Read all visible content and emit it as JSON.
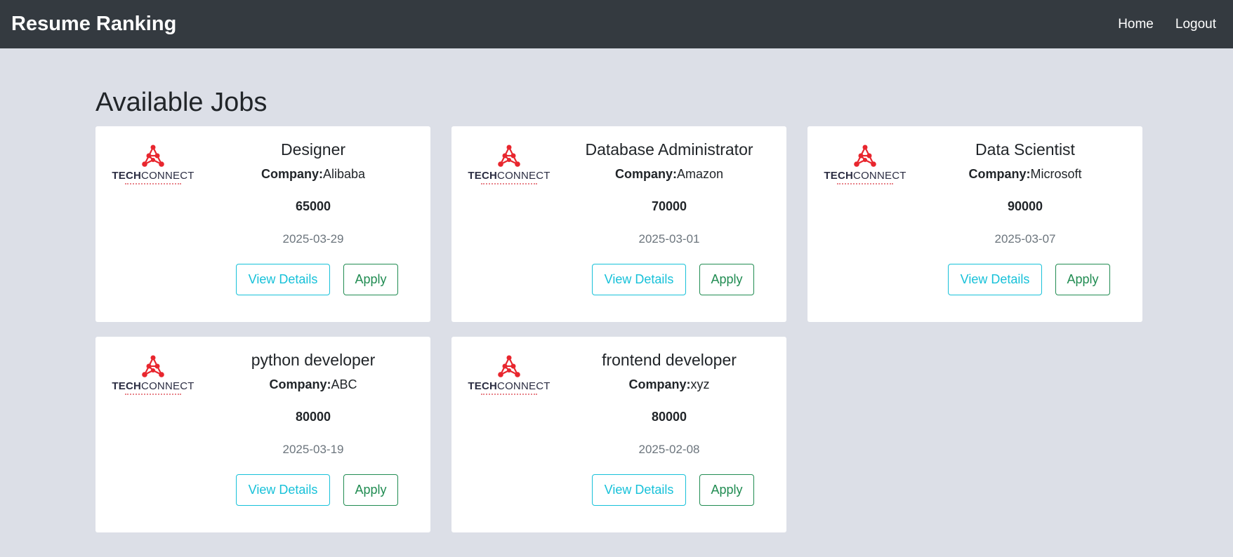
{
  "navbar": {
    "brand": "Resume Ranking",
    "links": [
      {
        "label": "Home"
      },
      {
        "label": "Logout"
      }
    ]
  },
  "page": {
    "title": "Available Jobs"
  },
  "logo": {
    "text_bold": "TECH",
    "text_light": "CONNECT",
    "color": "#e8262e"
  },
  "labels": {
    "company": "Company:",
    "view_details": "View Details",
    "apply": "Apply"
  },
  "colors": {
    "navbar": "#343a40",
    "background": "#dcdfe7",
    "info": "#17c1d9",
    "success": "#218c52"
  },
  "jobs": [
    {
      "title": "Designer",
      "company": "Alibaba",
      "salary": "65000",
      "date": "2025-03-29"
    },
    {
      "title": "Database Administrator",
      "company": "Amazon",
      "salary": "70000",
      "date": "2025-03-01"
    },
    {
      "title": "Data Scientist",
      "company": "Microsoft",
      "salary": "90000",
      "date": "2025-03-07"
    },
    {
      "title": "python developer",
      "company": "ABC",
      "salary": "80000",
      "date": "2025-03-19"
    },
    {
      "title": "frontend developer",
      "company": "xyz",
      "salary": "80000",
      "date": "2025-02-08"
    }
  ]
}
